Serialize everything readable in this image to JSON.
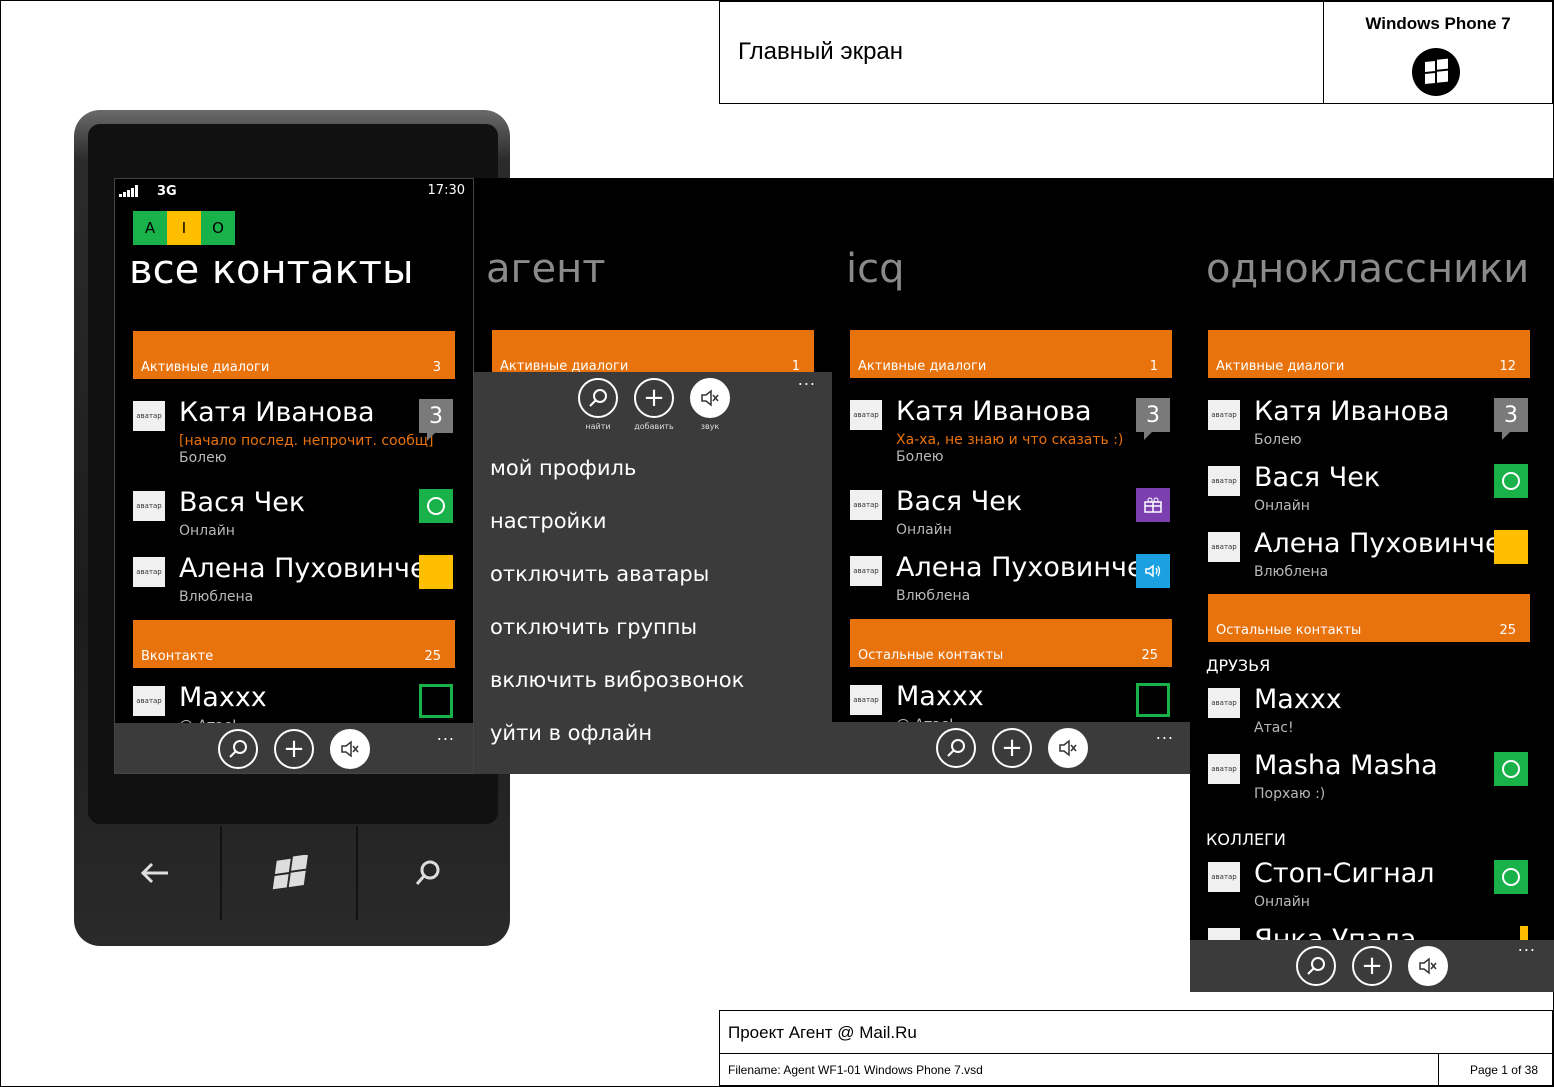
{
  "header": {
    "title": "Главный экран",
    "platform": "Windows Phone 7",
    "logo_icon": "windows-logo-icon"
  },
  "footer": {
    "project": "Проект Агент @ Mail.Ru",
    "filename": "Filename: Agent WF1-01 Windows Phone 7.vsd",
    "page": "Page 1 of 38"
  },
  "colors": {
    "accent": "#e8720c",
    "online": "#18b14a",
    "away": "#ffbf00",
    "appbar": "#3b3b3b"
  },
  "status": {
    "network": "3G",
    "time": "17:30"
  },
  "aio": [
    "A",
    "I",
    "O"
  ],
  "avatar_label": "аватар",
  "appbar": {
    "search_label": "найти",
    "add_label": "добавить",
    "sound_label": "звук",
    "more": "..."
  },
  "screen1": {
    "title": "все контакты",
    "group1": {
      "name": "Активные диалоги",
      "count": "3"
    },
    "contacts": [
      {
        "name": "Катя Иванова",
        "message": "[начало послед. непрочит. сообщ]",
        "status": "Болею",
        "badge": "3"
      },
      {
        "name": "Вася Чек",
        "status": "Онлайн"
      },
      {
        "name": "Алена Пуховинче",
        "status": "Влюблена"
      }
    ],
    "group2": {
      "name": "Вконтакте",
      "count": "25"
    },
    "last": {
      "name": "Maxxx",
      "status": "@ Атас!"
    }
  },
  "screen2": {
    "title": "агент",
    "group1": {
      "name": "Активные диалоги",
      "count": "1"
    },
    "menu": [
      "мой профиль",
      "настройки",
      "отключить аватары",
      "отключить группы",
      "включить виброзвонок",
      "уйти в офлайн"
    ]
  },
  "screen3": {
    "title": "icq",
    "group1": {
      "name": "Активные диалоги",
      "count": "1"
    },
    "contacts": [
      {
        "name": "Катя Иванова",
        "message": "Ха-ха, не знаю и что сказать :)",
        "status": "Болею",
        "badge": "3"
      },
      {
        "name": "Вася Чек",
        "status": "Онлайн"
      },
      {
        "name": "Алена Пуховинче",
        "status": "Влюблена"
      }
    ],
    "group2": {
      "name": "Остальные контакты",
      "count": "25"
    },
    "last": {
      "name": "Maxxx",
      "status": "@ Атас!"
    }
  },
  "screen4": {
    "title": "одноклассники",
    "group1": {
      "name": "Активные диалоги",
      "count": "12"
    },
    "contacts": [
      {
        "name": "Катя Иванова",
        "status": "Болею",
        "badge": "3"
      },
      {
        "name": "Вася Чек",
        "status": "Онлайн"
      },
      {
        "name": "Алена Пуховинче",
        "status": "Влюблена"
      }
    ],
    "group2": {
      "name": "Остальные контакты",
      "count": "25"
    },
    "section1": "ДРУЗЬЯ",
    "friends": [
      {
        "name": "Maxxx",
        "status": "Атас!"
      },
      {
        "name": "Masha Masha",
        "status": "Порхаю :)"
      }
    ],
    "section2": "КОЛЛЕГИ",
    "colleagues": [
      {
        "name": "Стоп-Сигнал",
        "status": "Онлайн"
      },
      {
        "name": "Янка Упала",
        "status": ""
      }
    ]
  },
  "phone_buttons": {
    "back": "back-arrow-icon",
    "start": "windows-start-icon",
    "search": "search-icon"
  }
}
